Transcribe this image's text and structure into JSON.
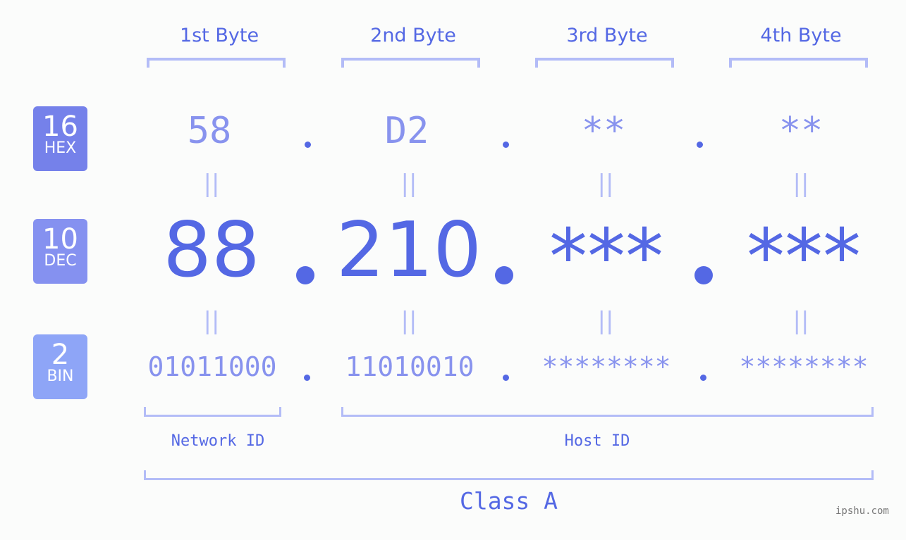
{
  "bytes": [
    {
      "label": "1st Byte",
      "hex": "58",
      "dec": "88",
      "bin": "01011000"
    },
    {
      "label": "2nd Byte",
      "hex": "D2",
      "dec": "210",
      "bin": "11010010"
    },
    {
      "label": "3rd Byte",
      "hex": "**",
      "dec": "***",
      "bin": "********"
    },
    {
      "label": "4th Byte",
      "hex": "**",
      "dec": "***",
      "bin": "********"
    }
  ],
  "badges": {
    "hex": {
      "num": "16",
      "label": "HEX",
      "color": "#7581ea"
    },
    "dec": {
      "num": "10",
      "label": "DEC",
      "color": "#8591f0"
    },
    "bin": {
      "num": "2",
      "label": "BIN",
      "color": "#8ea5f7"
    }
  },
  "equals_sign": "||",
  "network_id_label": "Network ID",
  "host_id_label": "Host ID",
  "class_label": "Class A",
  "watermark": "ipshu.com",
  "colors": {
    "primary": "#5468e4",
    "light": "#8893ee",
    "bracket": "#b3bcf7",
    "background": "#fbfcfb"
  }
}
